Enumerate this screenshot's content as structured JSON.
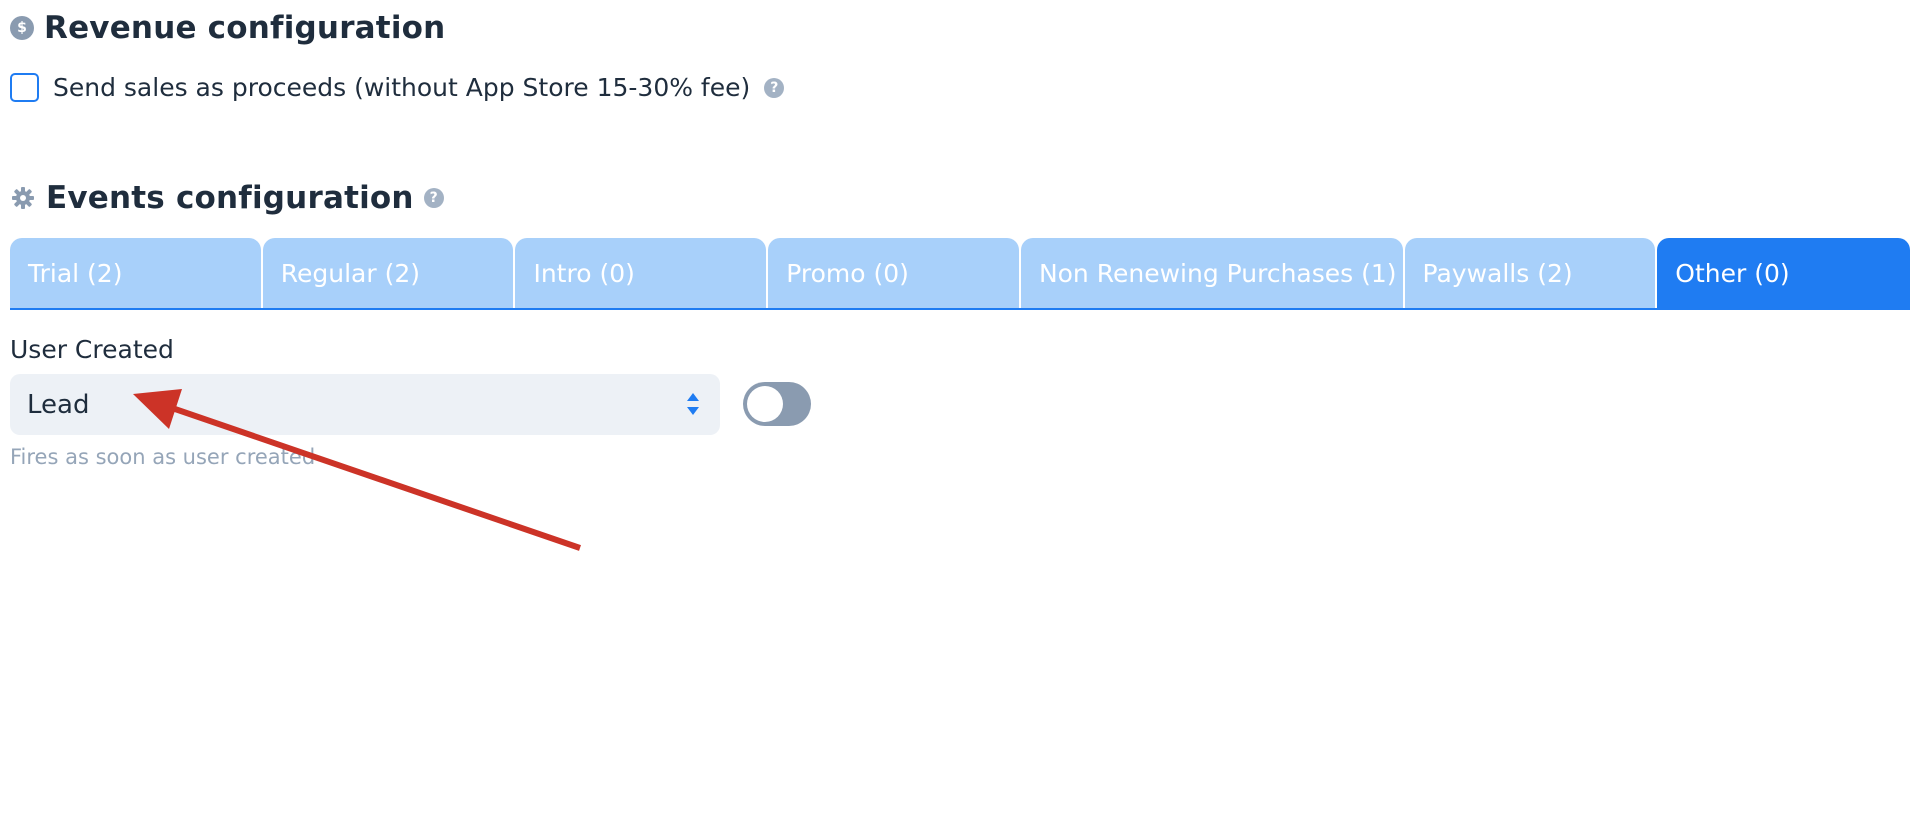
{
  "revenue": {
    "title": "Revenue configuration",
    "icon": "dollar-icon",
    "icon_glyph": "$",
    "checkbox_label": "Send sales as proceeds (without App Store 15-30% fee)",
    "checkbox_checked": false
  },
  "events": {
    "title": "Events configuration",
    "icon": "gear-icon",
    "tabs": [
      {
        "label": "Trial (2)",
        "active": false
      },
      {
        "label": "Regular (2)",
        "active": false
      },
      {
        "label": "Intro (0)",
        "active": false
      },
      {
        "label": "Promo (0)",
        "active": false
      },
      {
        "label": "Non Renewing Purchases (1)",
        "active": false
      },
      {
        "label": "Paywalls (2)",
        "active": false
      },
      {
        "label": "Other (0)",
        "active": true
      }
    ],
    "event": {
      "label": "User Created",
      "selected_value": "Lead",
      "toggle_on": false,
      "hint": "Fires as soon as user created"
    }
  },
  "help_glyph": "?",
  "colors": {
    "accent": "#1f7cf2",
    "tab_inactive": "#a8d0fa",
    "toggle_off": "#8a9bb0",
    "annotation_arrow": "#cc3327"
  }
}
